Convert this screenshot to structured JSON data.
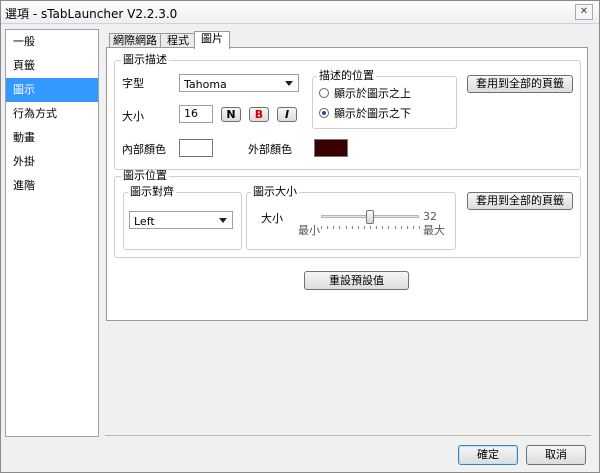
{
  "window": {
    "title": "選項 - sTabLauncher V2.2.3.0",
    "close_glyph": "✕"
  },
  "sidebar": {
    "items": [
      {
        "label": "一般"
      },
      {
        "label": "頁籤"
      },
      {
        "label": "圖示"
      },
      {
        "label": "行為方式"
      },
      {
        "label": "動畫"
      },
      {
        "label": "外掛"
      },
      {
        "label": "進階"
      }
    ],
    "selected_index": 2
  },
  "tabs": [
    {
      "label": "網際網路"
    },
    {
      "label": "程式"
    },
    {
      "label": "圖片"
    }
  ],
  "icon_desc": {
    "legend": "圖示描述",
    "font_label": "字型",
    "font_value": "Tahoma",
    "size_label": "大小",
    "size_value": "16",
    "style_normal": "N",
    "style_bold": "B",
    "style_italic": "I",
    "position_legend": "描述的位置",
    "position_above": "顯示於圖示之上",
    "position_below": "顯示於圖示之下",
    "position_selected": "below",
    "apply_all": "套用到全部的頁籤",
    "inner_color_label": "內部顏色",
    "inner_color": "#ffffff",
    "outer_color_label": "外部顏色",
    "outer_color": "#3a0000"
  },
  "icon_pos": {
    "legend": "圖示位置",
    "align_legend": "圖示對齊",
    "align_value": "Left",
    "size_legend": "圖示大小",
    "size_label": "大小",
    "slider_value": 16,
    "slider_max_label": "32",
    "slider_min_text": "最小",
    "slider_max_text": "最大",
    "apply_all": "套用到全部的頁籤"
  },
  "reset_button": "重設預設值",
  "footer": {
    "ok": "確定",
    "cancel": "取消"
  }
}
